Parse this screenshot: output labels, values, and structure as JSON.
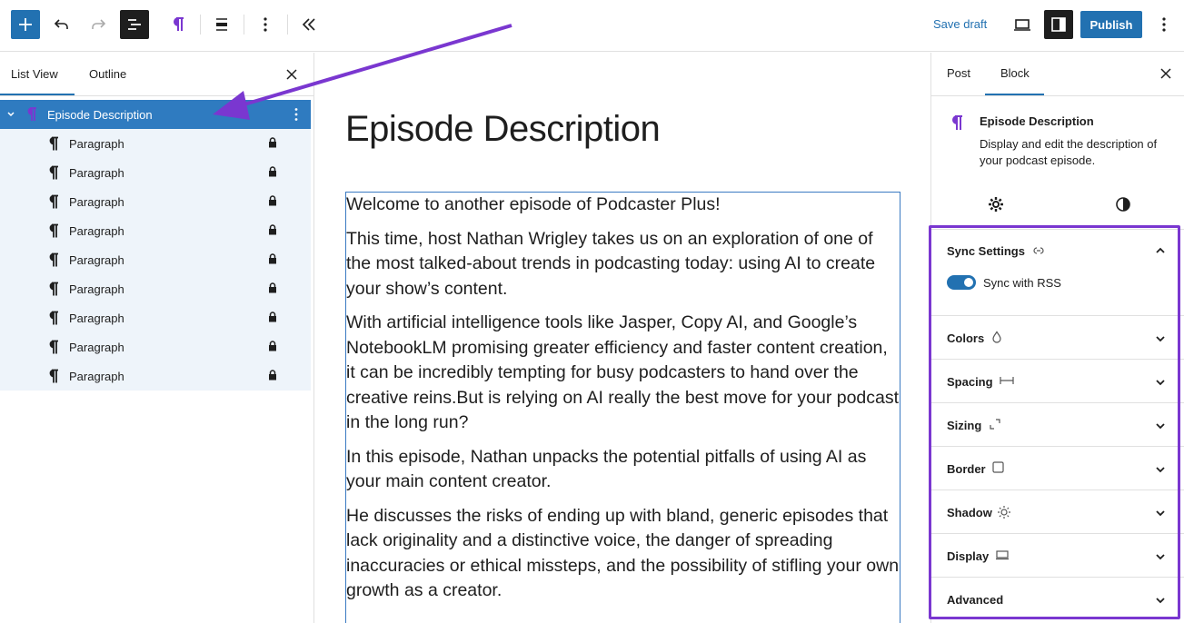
{
  "toolbar": {
    "save_draft": "Save draft",
    "publish": "Publish"
  },
  "list_panel": {
    "tabs": [
      "List View",
      "Outline"
    ],
    "root_label": "Episode Description",
    "items": [
      "Paragraph",
      "Paragraph",
      "Paragraph",
      "Paragraph",
      "Paragraph",
      "Paragraph",
      "Paragraph",
      "Paragraph",
      "Paragraph"
    ]
  },
  "editor": {
    "title": "Episode Description",
    "paragraphs": [
      "Welcome to another episode of Podcaster Plus!",
      "This time, host Nathan Wrigley takes us on an exploration of one of the most talked-about trends in podcasting today: using AI to create your show’s content.",
      "With artificial intelligence tools like Jasper, Copy AI, and Google’s NotebookLM promising greater efficiency and faster content creation, it can be incredibly tempting for busy podcasters to hand over the creative reins.But is relying on AI really the best move for your podcast in the long run?",
      "In this episode, Nathan unpacks the potential pitfalls of using AI as your main content creator.",
      "He discusses the risks of ending up with bland, generic episodes that lack originality and a distinctive voice, the danger of spreading inaccuracies or ethical missteps, and the possibility of stifling your own growth as a creator."
    ]
  },
  "sidebar": {
    "tabs": [
      "Post",
      "Block"
    ],
    "block_title": "Episode Description",
    "block_desc": "Display and edit the description of your podcast episode.",
    "sync_title": "Sync Settings",
    "sync_toggle_label": "Sync with RSS",
    "panels": [
      "Colors",
      "Spacing",
      "Sizing",
      "Border",
      "Shadow",
      "Display",
      "Advanced"
    ]
  },
  "colors": {
    "accent": "#2271b1",
    "highlight": "#7a37d0",
    "paragraph_icon": "#7a37d0"
  }
}
